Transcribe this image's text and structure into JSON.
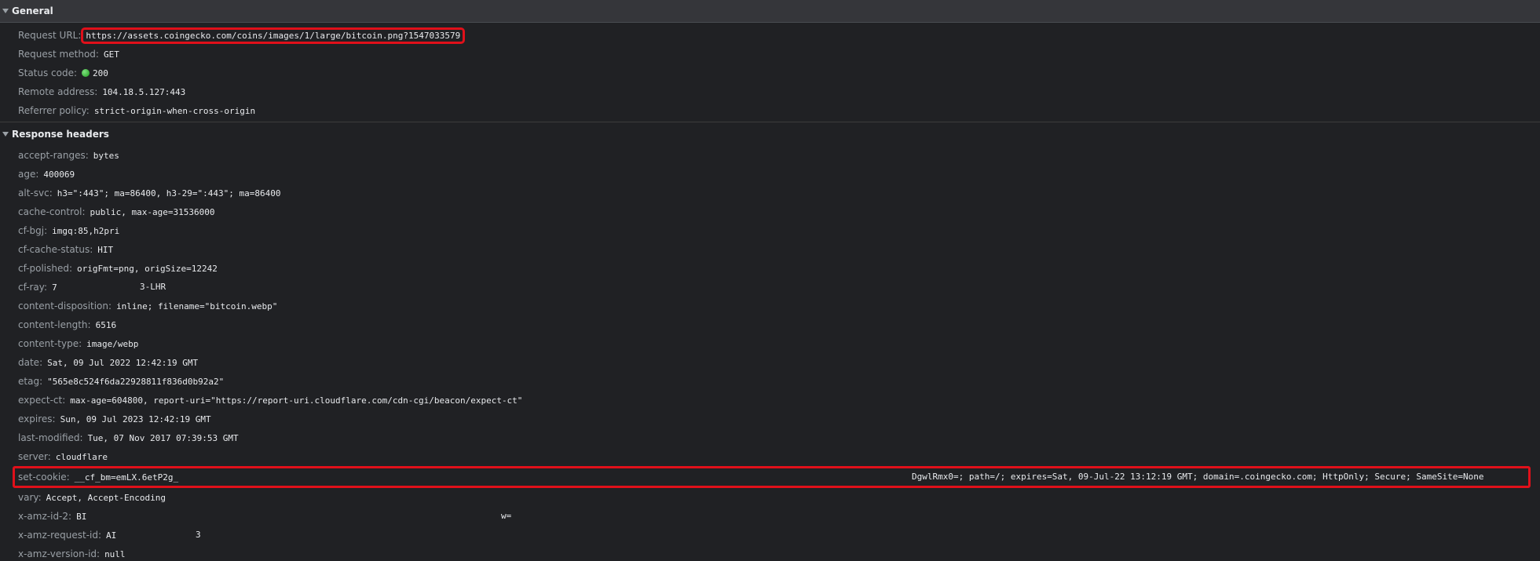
{
  "general": {
    "title": "General",
    "request_url_label": "Request URL",
    "request_url": "https://assets.coingecko.com/coins/images/1/large/bitcoin.png?1547033579",
    "request_method_label": "Request method",
    "request_method": "GET",
    "status_code_label": "Status code",
    "status_code": "200",
    "remote_address_label": "Remote address",
    "remote_address": "104.18.5.127:443",
    "referrer_policy_label": "Referrer policy",
    "referrer_policy": "strict-origin-when-cross-origin"
  },
  "response": {
    "title": "Response headers",
    "headers": [
      {
        "key": "accept-ranges",
        "value": "bytes"
      },
      {
        "key": "age",
        "value": "400069"
      },
      {
        "key": "alt-svc",
        "value": "h3=\":443\"; ma=86400, h3-29=\":443\"; ma=86400"
      },
      {
        "key": "cache-control",
        "value": "public, max-age=31536000"
      },
      {
        "key": "cf-bgj",
        "value": "imgq:85,h2pri"
      },
      {
        "key": "cf-cache-status",
        "value": "HIT"
      },
      {
        "key": "cf-polished",
        "value": "origFmt=png, origSize=12242"
      },
      {
        "key": "cf-ray",
        "value": "7",
        "value_tail": "3-LHR"
      },
      {
        "key": "content-disposition",
        "value": "inline; filename=\"bitcoin.webp\""
      },
      {
        "key": "content-length",
        "value": "6516"
      },
      {
        "key": "content-type",
        "value": "image/webp"
      },
      {
        "key": "date",
        "value": "Sat, 09 Jul 2022 12:42:19 GMT"
      },
      {
        "key": "etag",
        "value": "\"565e8c524f6da22928811f836d0b92a2\""
      },
      {
        "key": "expect-ct",
        "value": "max-age=604800, report-uri=\"https://report-uri.cloudflare.com/cdn-cgi/beacon/expect-ct\""
      },
      {
        "key": "expires",
        "value": "Sun, 09 Jul 2023 12:42:19 GMT"
      },
      {
        "key": "last-modified",
        "value": "Tue, 07 Nov 2017 07:39:53 GMT"
      },
      {
        "key": "server",
        "value": "cloudflare"
      },
      {
        "key": "set-cookie",
        "value": "__cf_bm=emLX.6etP2g_",
        "value_tail": "DgwlRmx0=; path=/; expires=Sat, 09-Jul-22 13:12:19 GMT; domain=.coingecko.com; HttpOnly; Secure; SameSite=None"
      },
      {
        "key": "vary",
        "value": "Accept, Accept-Encoding"
      },
      {
        "key": "x-amz-id-2",
        "value": "BI",
        "value_tail": "w="
      },
      {
        "key": "x-amz-request-id",
        "value": "AI",
        "value_tail": "3"
      },
      {
        "key": "x-amz-version-id",
        "value": "null"
      }
    ]
  },
  "colors": {
    "background": "#202124",
    "header_bg": "#35363a",
    "key": "#9aa0a6",
    "value": "#e8eaed",
    "highlight": "#e0101a",
    "status_ok": "#1e9e1e"
  },
  "icons": {
    "section_toggle": "triangle-down-icon",
    "status": "status-ok-dot-icon"
  }
}
